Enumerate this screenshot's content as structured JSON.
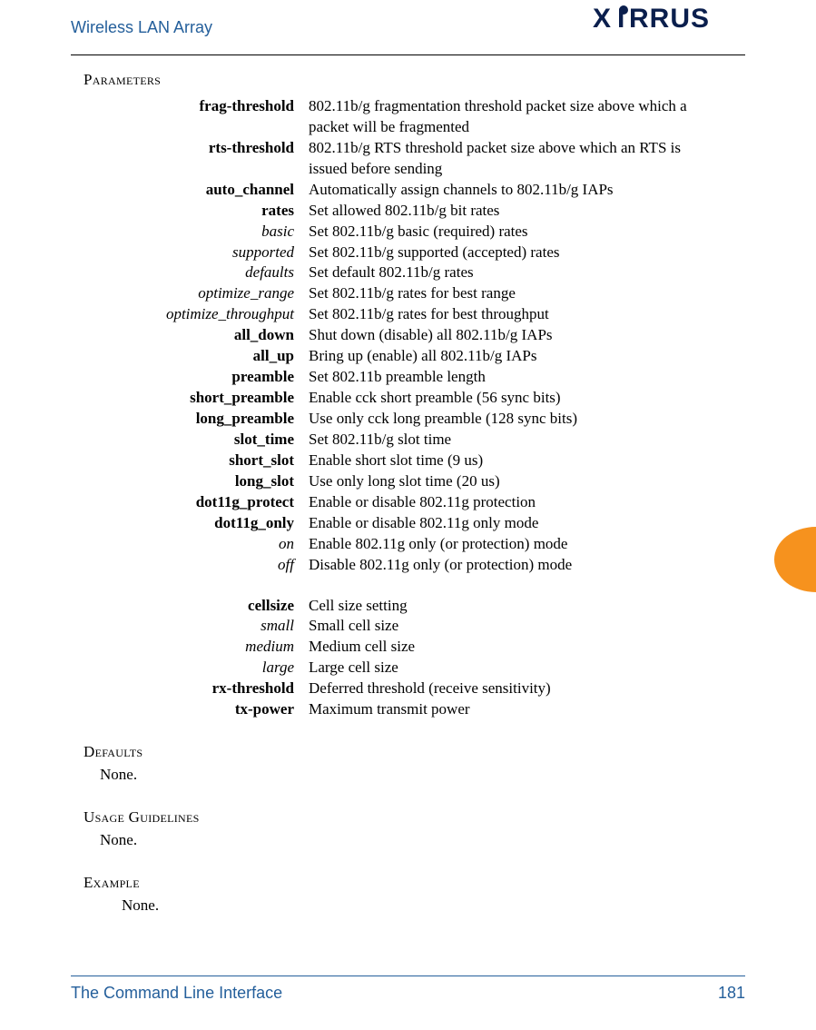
{
  "header": {
    "title": "Wireless LAN Array",
    "brand_text": "RRUS",
    "brand_prefix": "X"
  },
  "section_labels": {
    "parameters": "Parameters",
    "defaults": "Defaults",
    "usage": "Usage Guidelines",
    "example": "Example"
  },
  "parameters": [
    {
      "term": "frag-threshold",
      "style": "bold",
      "desc": "802.11b/g fragmentation threshold packet size above which a packet will be fragmented"
    },
    {
      "term": "rts-threshold",
      "style": "bold",
      "desc": "802.11b/g RTS threshold packet size above which an RTS is issued before sending"
    },
    {
      "term": "auto_channel",
      "style": "bold",
      "desc": "Automatically assign channels to 802.11b/g IAPs"
    },
    {
      "term": "rates",
      "style": "bold",
      "desc": "Set allowed 802.11b/g bit rates"
    },
    {
      "term": "basic",
      "style": "ital",
      "desc": "Set 802.11b/g basic (required) rates"
    },
    {
      "term": "supported",
      "style": "ital",
      "desc": "Set 802.11b/g supported (accepted) rates"
    },
    {
      "term": "defaults",
      "style": "ital",
      "desc": "Set default 802.11b/g rates"
    },
    {
      "term": "optimize_range",
      "style": "ital",
      "desc": "Set 802.11b/g rates for best range"
    },
    {
      "term": "optimize_throughput",
      "style": "ital",
      "desc": "Set 802.11b/g rates for best throughput"
    },
    {
      "term": "all_down",
      "style": "bold",
      "desc": "Shut down (disable) all 802.11b/g IAPs"
    },
    {
      "term": "all_up",
      "style": "bold",
      "desc": "Bring up (enable) all 802.11b/g IAPs"
    },
    {
      "term": "preamble",
      "style": "bold",
      "desc": "Set 802.11b preamble length"
    },
    {
      "term": "short_preamble",
      "style": "bold",
      "desc": "Enable cck short preamble (56 sync bits)"
    },
    {
      "term": "long_preamble",
      "style": "bold",
      "desc": "Use only cck long preamble (128 sync bits)"
    },
    {
      "term": "slot_time",
      "style": "bold",
      "desc": "Set 802.11b/g slot time"
    },
    {
      "term": "short_slot",
      "style": "bold",
      "desc": "Enable short slot time (9 us)"
    },
    {
      "term": "long_slot",
      "style": "bold",
      "desc": "Use only long slot time (20 us)"
    },
    {
      "term": "dot11g_protect",
      "style": "bold",
      "desc": "Enable or disable 802.11g protection"
    },
    {
      "term": "dot11g_only",
      "style": "bold",
      "desc": "Enable or disable 802.11g only mode"
    },
    {
      "term": "on",
      "style": "ital",
      "desc": "Enable 802.11g only (or protection) mode"
    },
    {
      "term": "off",
      "style": "ital",
      "desc": "Disable 802.11g only (or protection) mode"
    }
  ],
  "parameters2": [
    {
      "term": "cellsize",
      "style": "bold",
      "desc": "Cell size setting"
    },
    {
      "term": "small",
      "style": "ital",
      "desc": "Small cell size"
    },
    {
      "term": "medium",
      "style": "ital",
      "desc": "Medium cell size"
    },
    {
      "term": "large",
      "style": "ital",
      "desc": "Large cell size"
    },
    {
      "term": "rx-threshold",
      "style": "bold",
      "desc": "Deferred threshold (receive sensitivity)"
    },
    {
      "term": "tx-power",
      "style": "bold",
      "desc": "Maximum transmit power"
    }
  ],
  "defaults_body": "None.",
  "usage_body": "None.",
  "example_body": "None.",
  "footer": {
    "text": "The Command Line Interface",
    "page": "181"
  },
  "colors": {
    "accent_blue": "#245f9b",
    "tab_orange": "#f6921e"
  }
}
